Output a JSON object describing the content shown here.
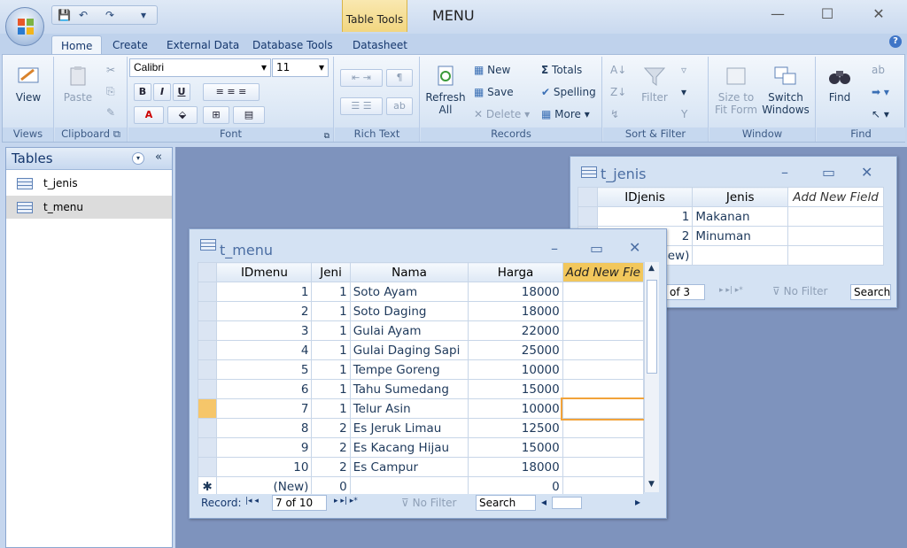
{
  "window": {
    "title": "MENU",
    "context_tab": "Table Tools",
    "minimize": "—",
    "maximize": "☐",
    "close": "✕"
  },
  "qat": {
    "save": "💾",
    "undo": "↶",
    "redo": "↷",
    "more": "▾"
  },
  "tabs": [
    "Home",
    "Create",
    "External Data",
    "Database Tools",
    "Datasheet"
  ],
  "help": "?",
  "ribbon": {
    "views": {
      "label": "Views",
      "view": "View"
    },
    "clipboard": {
      "label": "Clipboard",
      "paste": "Paste",
      "launcher": "⧉"
    },
    "font": {
      "label": "Font",
      "name": "Calibri",
      "size": "11",
      "bold": "B",
      "italic": "I",
      "underline": "U",
      "color": "A",
      "launcher": "⧉"
    },
    "richtext": {
      "label": "Rich Text"
    },
    "records": {
      "label": "Records",
      "refresh": "Refresh All",
      "new": "New",
      "save": "Save",
      "delete": "Delete",
      "totals": "Totals",
      "spelling": "Spelling",
      "more": "More"
    },
    "sortfilter": {
      "label": "Sort & Filter",
      "filter": "Filter"
    },
    "window": {
      "label": "Window",
      "size": "Size to Fit Form",
      "switch": "Switch Windows"
    },
    "find": {
      "label": "Find",
      "find": "Find"
    }
  },
  "nav": {
    "title": "Tables",
    "items": [
      "t_jenis",
      "t_menu"
    ]
  },
  "t_menu": {
    "title": "t_menu",
    "columns": [
      "IDmenu",
      "Jeni",
      "Nama",
      "Harga",
      "Add New Fie"
    ],
    "rows": [
      [
        "1",
        "1",
        "Soto Ayam",
        "18000"
      ],
      [
        "2",
        "1",
        "Soto Daging",
        "18000"
      ],
      [
        "3",
        "1",
        "Gulai Ayam",
        "22000"
      ],
      [
        "4",
        "1",
        "Gulai Daging Sapi",
        "25000"
      ],
      [
        "5",
        "1",
        "Tempe Goreng",
        "10000"
      ],
      [
        "6",
        "1",
        "Tahu Sumedang",
        "15000"
      ],
      [
        "7",
        "1",
        "Telur Asin",
        "10000"
      ],
      [
        "8",
        "2",
        "Es Jeruk Limau",
        "12500"
      ],
      [
        "9",
        "2",
        "Es Kacang Hijau",
        "15000"
      ],
      [
        "10",
        "2",
        "Es Campur",
        "18000"
      ]
    ],
    "new_row": {
      "marker": "✱",
      "id": "(New)",
      "jenis": "0",
      "harga": "0"
    },
    "record_label": "Record:",
    "record_pos": "7 of 10",
    "no_filter": "No Filter",
    "search": "Search"
  },
  "t_jenis": {
    "title": "t_jenis",
    "columns": [
      "IDjenis",
      "Jenis",
      "Add New Field"
    ],
    "rows": [
      [
        "1",
        "Makanan"
      ],
      [
        "2",
        "Minuman"
      ]
    ],
    "new_row_text": "lew)",
    "record_pos": "of 3",
    "no_filter": "No Filter",
    "search": "Search"
  }
}
